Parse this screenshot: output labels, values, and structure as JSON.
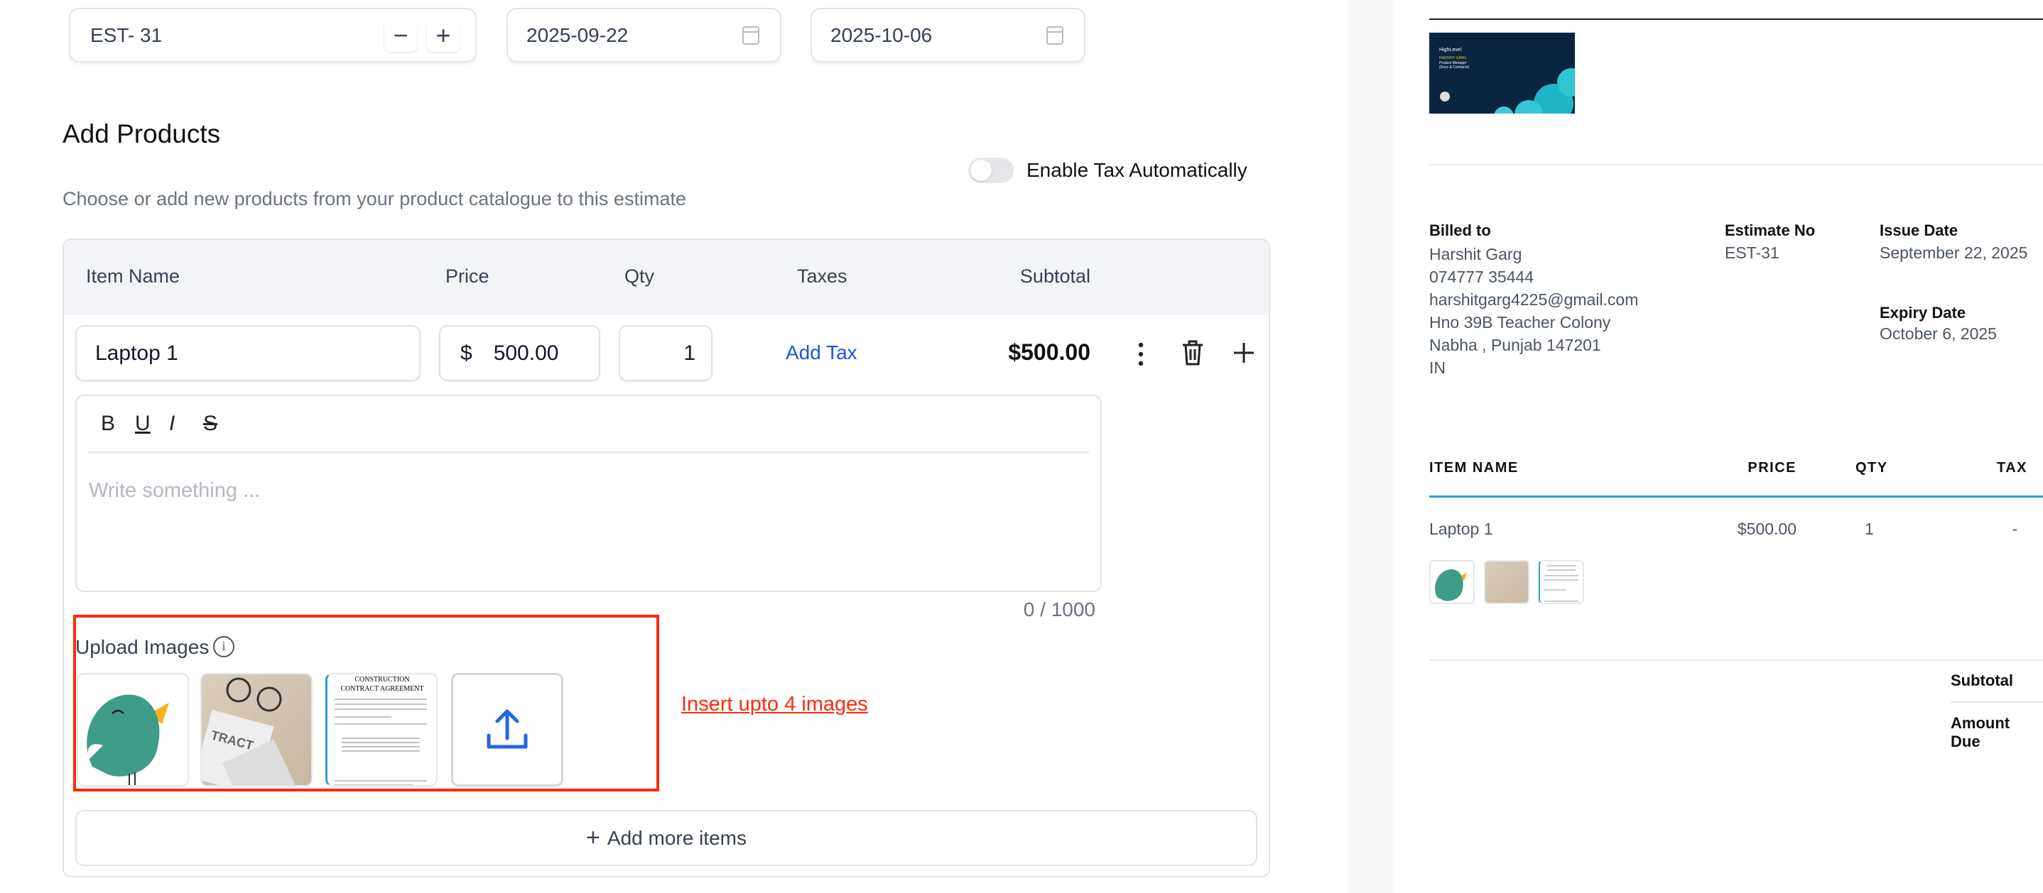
{
  "header_fields": {
    "estimate_number": "EST- 31",
    "decrement": "−",
    "increment": "+",
    "issue_date": "2025-09-22",
    "expiry_date": "2025-10-06"
  },
  "products": {
    "title": "Add Products",
    "subtitle": "Choose or add new products from your product catalogue to this estimate",
    "tax_toggle_label": "Enable Tax Automatically",
    "tax_toggle_on": false,
    "columns": [
      "Item Name",
      "Price",
      "Qty",
      "Taxes",
      "Subtotal"
    ],
    "item": {
      "name": "Laptop 1",
      "currency": "$",
      "price": "500.00",
      "qty": "1",
      "add_tax": "Add Tax",
      "subtotal": "$500.00"
    },
    "editor": {
      "toolbar": [
        "B",
        "U",
        "I",
        "S"
      ],
      "placeholder": "Write something ...",
      "counter": "0 / 1000"
    },
    "upload": {
      "label": "Upload Images",
      "hint": "Insert upto 4 images",
      "hint_color": "#ff2a0a"
    },
    "add_more": "Add more items"
  },
  "preview": {
    "logo": {
      "brand": "HighLevel",
      "name": "HARSHIT GARG",
      "role": "Product Manager",
      "team": "(Docs & Contracts)"
    },
    "billed_to": {
      "label": "Billed to",
      "lines": [
        "Harshit Garg",
        "074777 35444",
        "harshitgarg4225@gmail.com",
        "Hno 39B Teacher Colony",
        "Nabha , Punjab 147201",
        "IN"
      ]
    },
    "estimate_no": {
      "label": "Estimate No",
      "value": "EST-31"
    },
    "issue_date": {
      "label": "Issue Date",
      "value": "September 22, 2025"
    },
    "expiry_date": {
      "label": "Expiry Date",
      "value": "October 6, 2025"
    },
    "columns": [
      "ITEM NAME",
      "PRICE",
      "QTY",
      "TAX"
    ],
    "row": {
      "name": "Laptop 1",
      "price": "$500.00",
      "qty": "1",
      "tax": "-"
    },
    "subtotal_label": "Subtotal",
    "amount_due_label": "Amount Due",
    "accent": "#2d9cdb"
  }
}
